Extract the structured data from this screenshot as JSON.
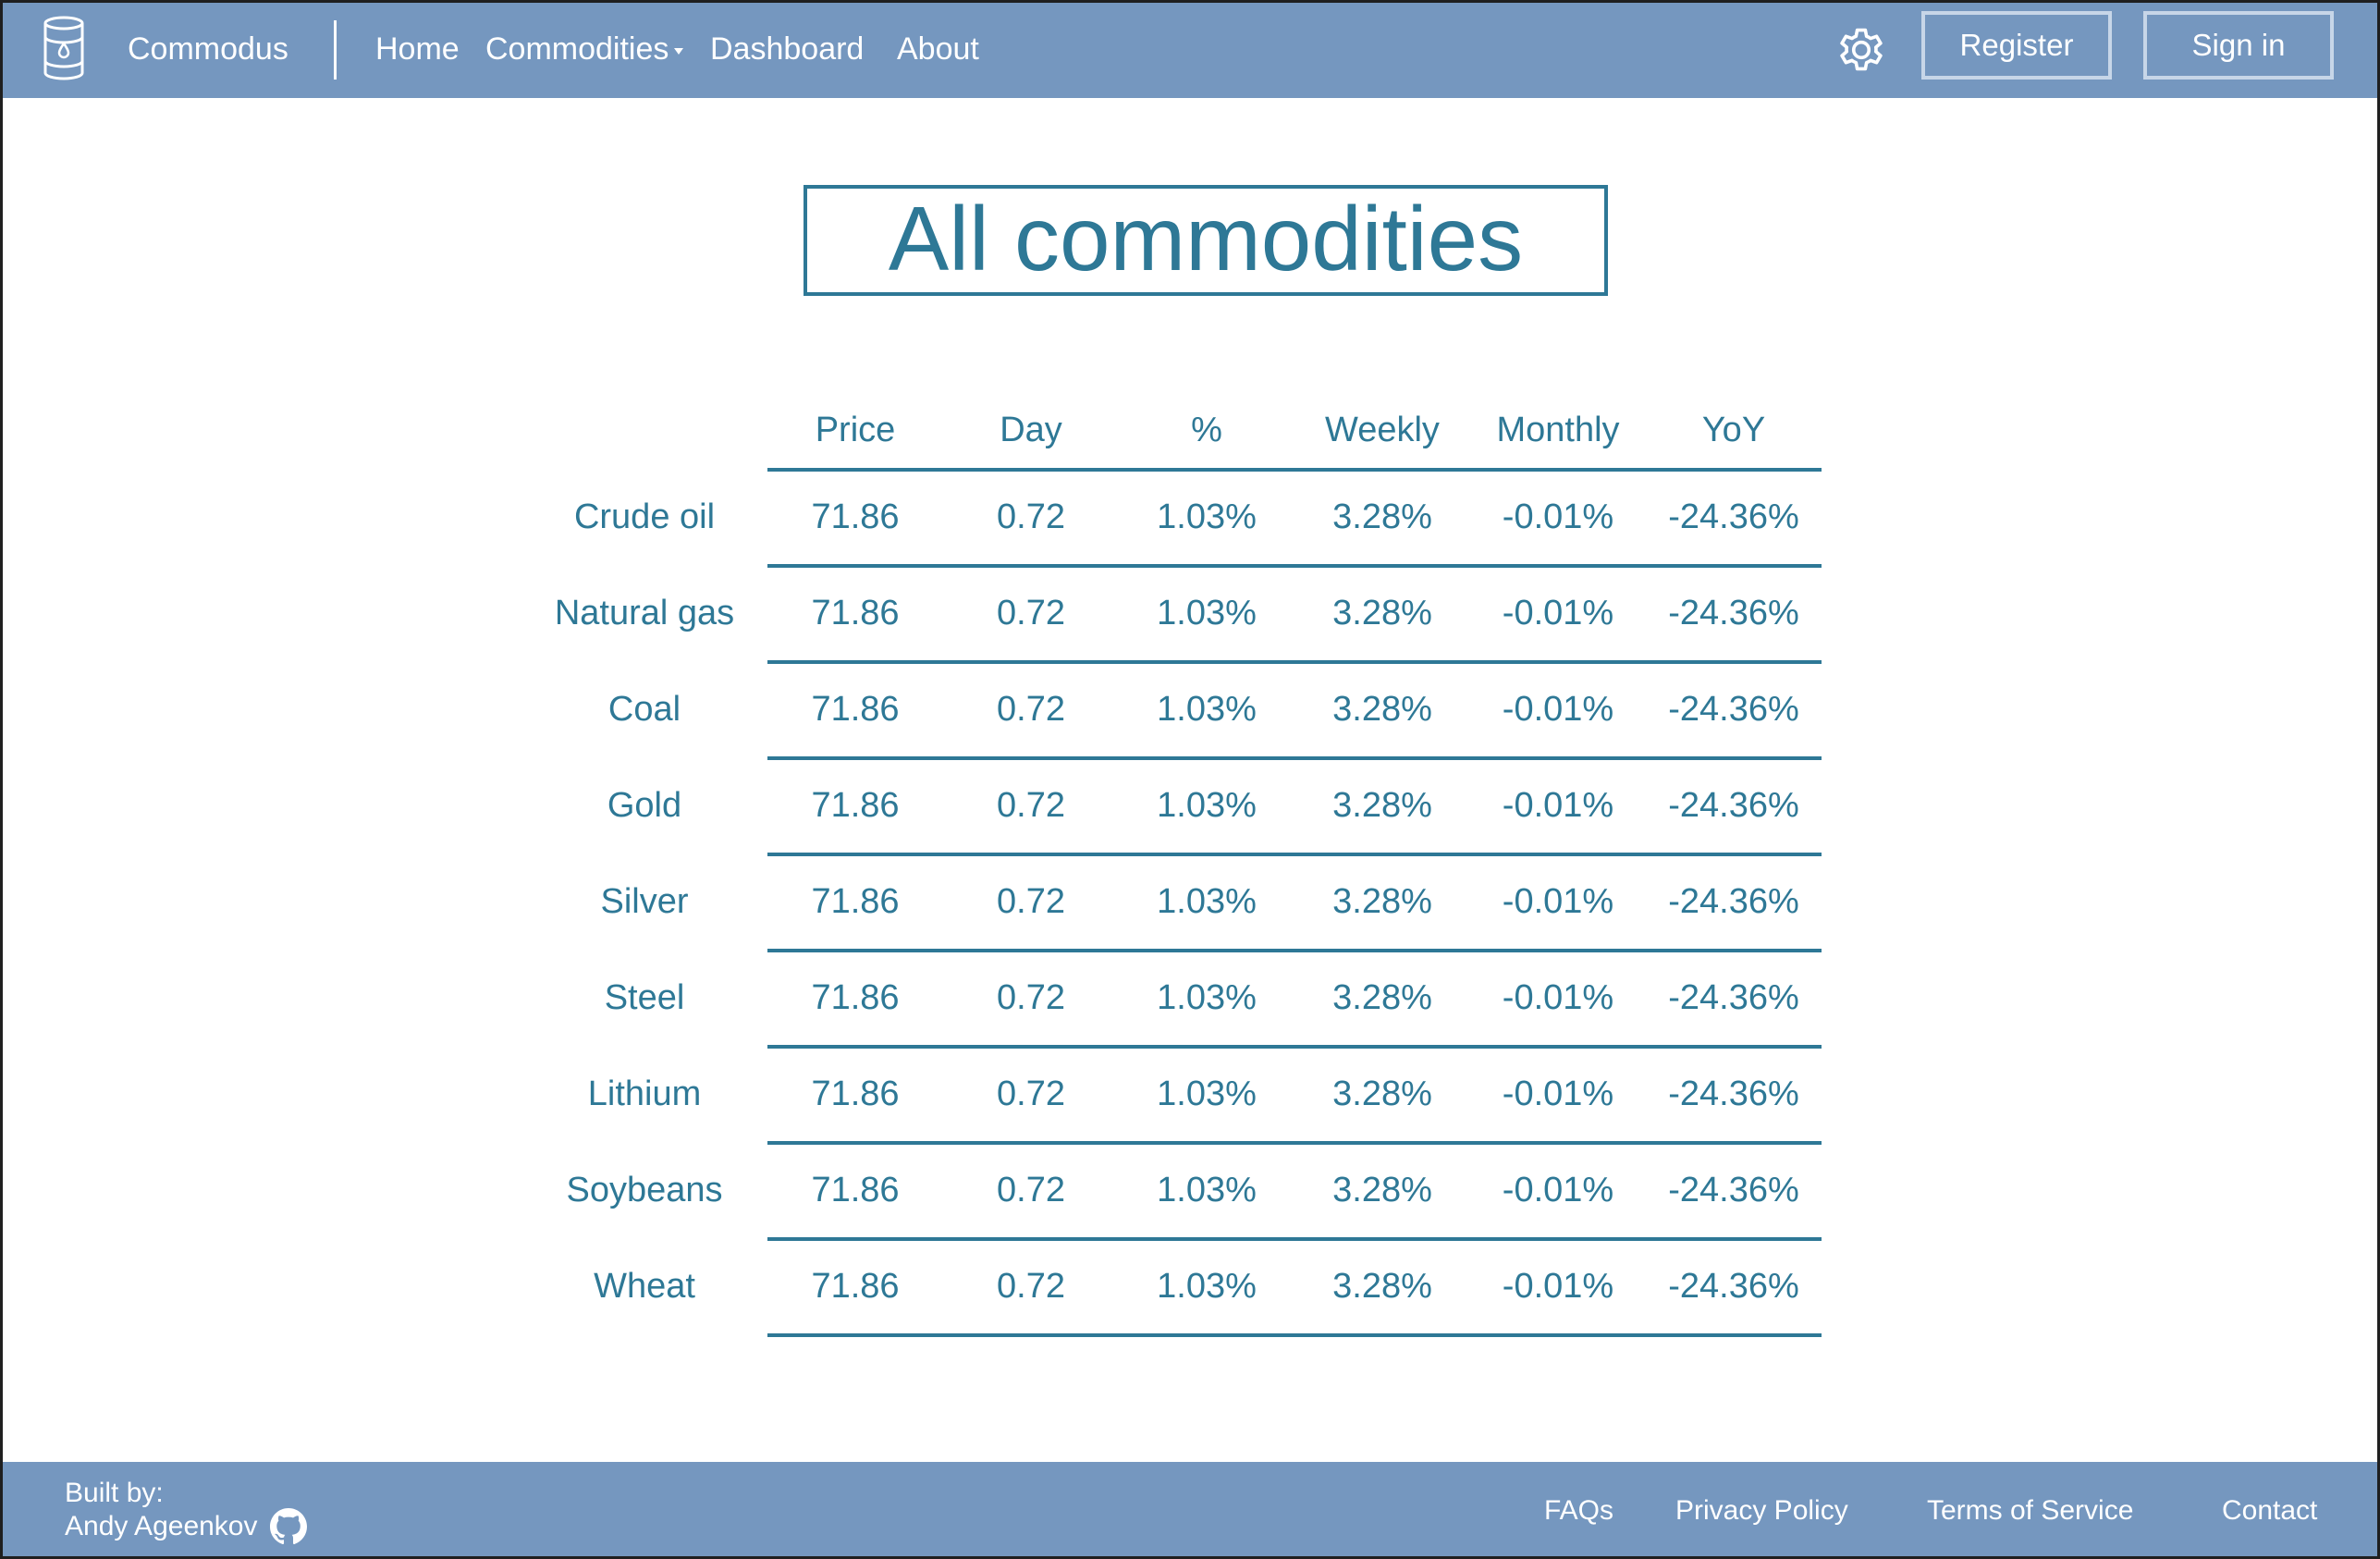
{
  "nav": {
    "brand": "Commodus",
    "links": [
      {
        "label": "Home"
      },
      {
        "label": "Commodities"
      },
      {
        "label": "Dashboard"
      },
      {
        "label": "About"
      }
    ],
    "settings_icon": "gear-icon",
    "logo_icon": "oil-barrel-icon",
    "register_label": "Register",
    "signin_label": "Sign in"
  },
  "page": {
    "title": "All commodities"
  },
  "table": {
    "columns": [
      "Price",
      "Day",
      "%",
      "Weekly",
      "Monthly",
      "YoY"
    ],
    "rows": [
      {
        "name": "Crude oil",
        "values": [
          "71.86",
          "0.72",
          "1.03%",
          "3.28%",
          "-0.01%",
          "-24.36%"
        ]
      },
      {
        "name": "Natural gas",
        "values": [
          "71.86",
          "0.72",
          "1.03%",
          "3.28%",
          "-0.01%",
          "-24.36%"
        ]
      },
      {
        "name": "Coal",
        "values": [
          "71.86",
          "0.72",
          "1.03%",
          "3.28%",
          "-0.01%",
          "-24.36%"
        ]
      },
      {
        "name": "Gold",
        "values": [
          "71.86",
          "0.72",
          "1.03%",
          "3.28%",
          "-0.01%",
          "-24.36%"
        ]
      },
      {
        "name": "Silver",
        "values": [
          "71.86",
          "0.72",
          "1.03%",
          "3.28%",
          "-0.01%",
          "-24.36%"
        ]
      },
      {
        "name": "Steel",
        "values": [
          "71.86",
          "0.72",
          "1.03%",
          "3.28%",
          "-0.01%",
          "-24.36%"
        ]
      },
      {
        "name": "Lithium",
        "values": [
          "71.86",
          "0.72",
          "1.03%",
          "3.28%",
          "-0.01%",
          "-24.36%"
        ]
      },
      {
        "name": "Soybeans",
        "values": [
          "71.86",
          "0.72",
          "1.03%",
          "3.28%",
          "-0.01%",
          "-24.36%"
        ]
      },
      {
        "name": "Wheat",
        "values": [
          "71.86",
          "0.72",
          "1.03%",
          "3.28%",
          "-0.01%",
          "-24.36%"
        ]
      }
    ]
  },
  "footer": {
    "built_by": "Built by:",
    "author": "Andy Ageenkov",
    "author_icon": "github-icon",
    "links": [
      {
        "label": "FAQs"
      },
      {
        "label": "Privacy Policy"
      },
      {
        "label": "Terms of Service"
      },
      {
        "label": "Contact"
      }
    ]
  },
  "colors": {
    "nav_bg": "#7597bf",
    "accent": "#2e7896",
    "button_border": "#c7d6e8"
  }
}
